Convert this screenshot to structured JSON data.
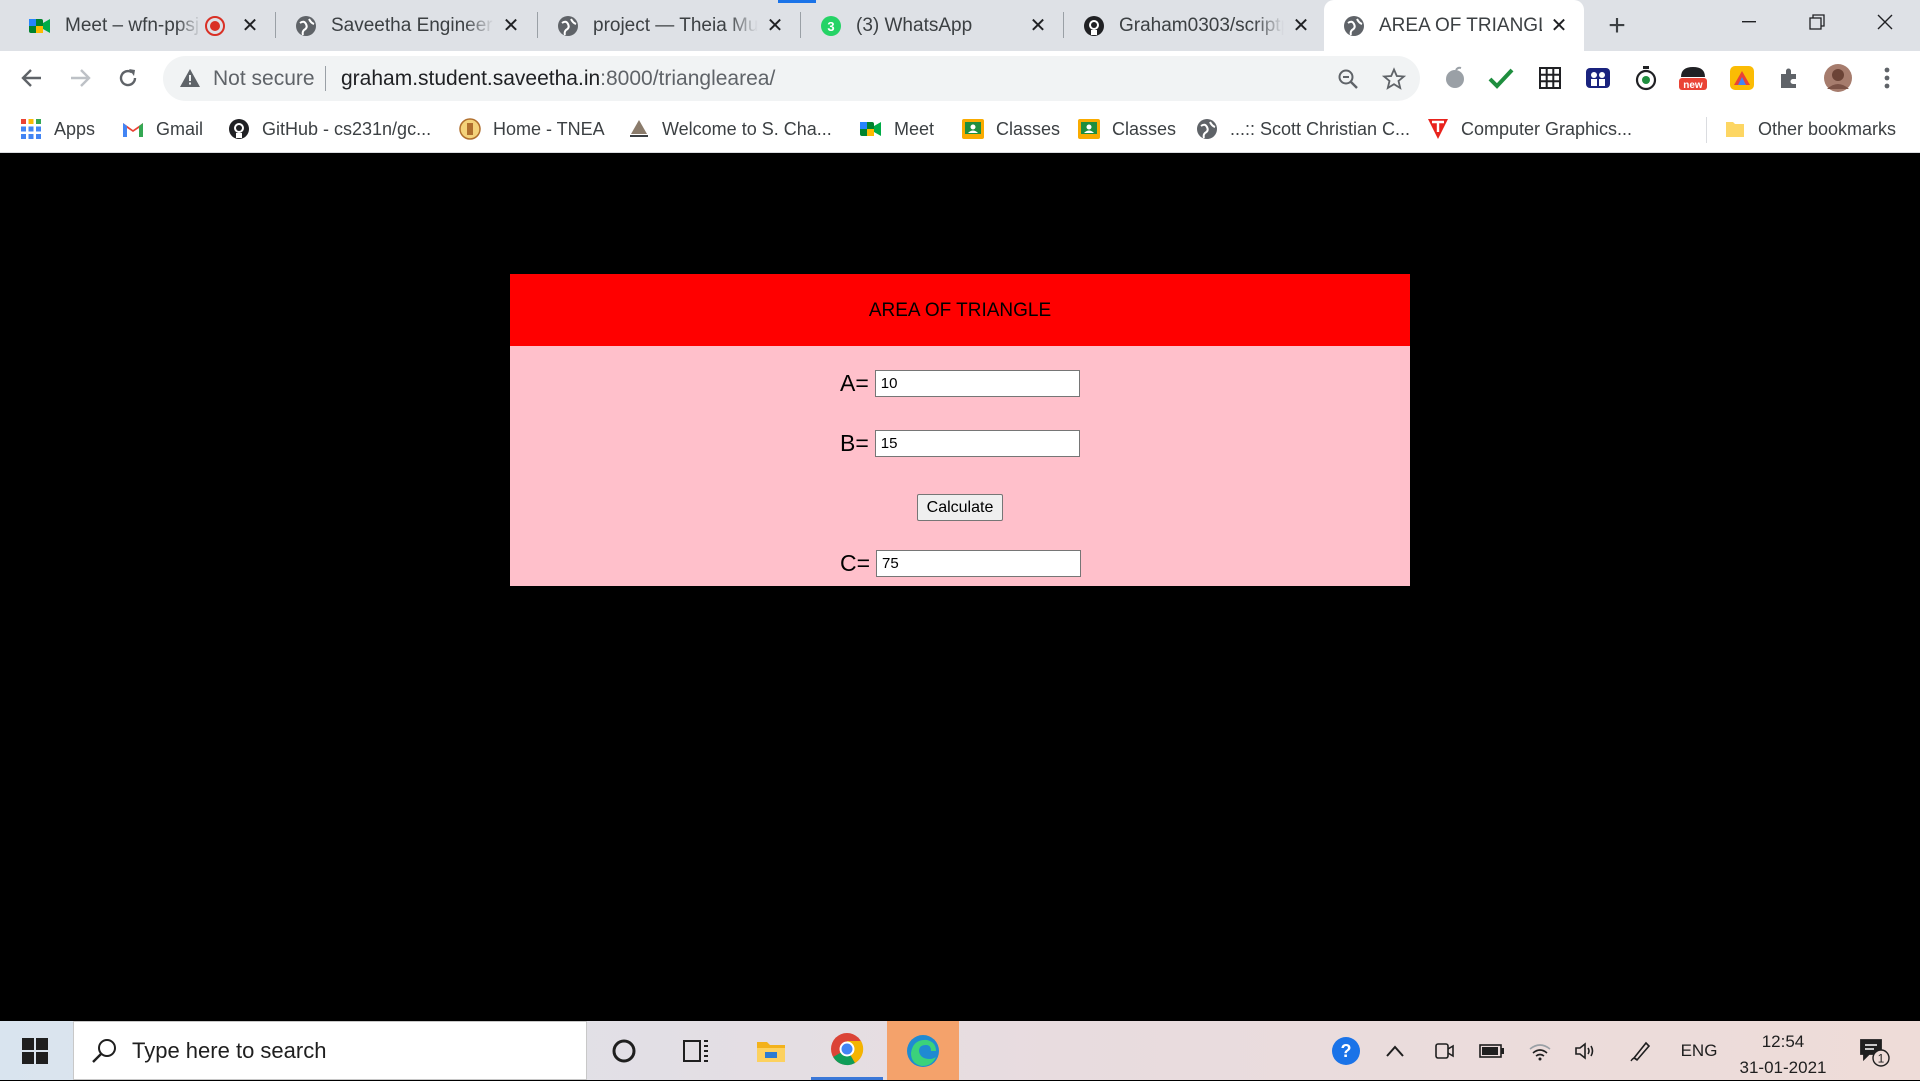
{
  "browser": {
    "tabs": [
      {
        "title": "Meet – wfn-ppsj",
        "icon": "google-meet-icon"
      },
      {
        "title": "Saveetha Engineering",
        "icon": "globe-icon"
      },
      {
        "title": "project — Theia Multi",
        "icon": "globe-icon"
      },
      {
        "title": "(3) WhatsApp",
        "icon": "whatsapp-icon",
        "badge": "3"
      },
      {
        "title": "Graham0303/scriptp",
        "icon": "github-icon"
      },
      {
        "title": "AREA OF TRIANGLE",
        "icon": "globe-icon",
        "active": true
      }
    ],
    "address_bar": {
      "security_text": "Not secure",
      "url_host": "graham.student.saveetha.in",
      "url_rest": ":8000/trianglearea/"
    },
    "extension_badge": "new",
    "bookmarks": [
      {
        "label": "Apps",
        "icon": "apps-grid-icon"
      },
      {
        "label": "Gmail",
        "icon": "gmail-icon"
      },
      {
        "label": "GitHub - cs231n/gc...",
        "icon": "github-icon"
      },
      {
        "label": "Home - TNEA",
        "icon": "emblem-icon"
      },
      {
        "label": "Welcome to S. Cha...",
        "icon": "temple-icon"
      },
      {
        "label": "Meet",
        "icon": "google-meet-icon"
      },
      {
        "label": "Classes",
        "icon": "classroom-icon"
      },
      {
        "label": "Classes",
        "icon": "classroom-icon"
      },
      {
        "label": "...:: Scott Christian C...",
        "icon": "globe-icon"
      },
      {
        "label": "Computer Graphics...",
        "icon": "t-logo-icon"
      }
    ],
    "other_bookmarks": "Other bookmarks"
  },
  "page": {
    "heading": "AREA OF TRIANGLE",
    "fields": {
      "a": {
        "label": "A=",
        "value": "10"
      },
      "b": {
        "label": "B=",
        "value": "15"
      },
      "c": {
        "label": "C=",
        "value": "75"
      }
    },
    "calculate_label": "Calculate"
  },
  "taskbar": {
    "search_placeholder": "Type here to search",
    "language": "ENG",
    "time": "12:54",
    "date": "31-01-2021",
    "notification_count": "1"
  },
  "colors": {
    "header_red": "#ff0000",
    "card_pink": "#ffc0cb",
    "page_background": "#000000"
  }
}
